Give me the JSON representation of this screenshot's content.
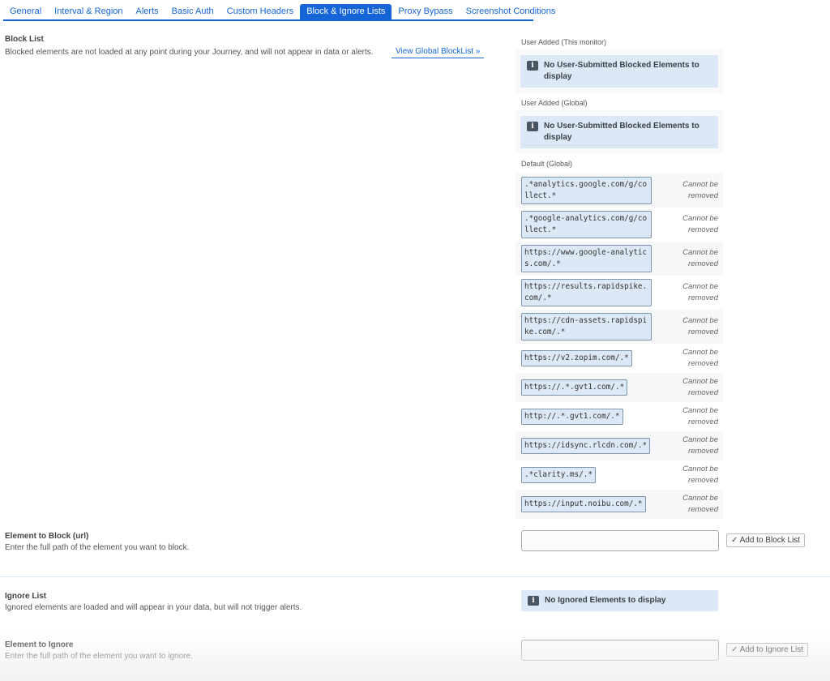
{
  "tabs": [
    {
      "label": "General",
      "active": false
    },
    {
      "label": "Interval & Region",
      "active": false
    },
    {
      "label": "Alerts",
      "active": false
    },
    {
      "label": "Basic Auth",
      "active": false
    },
    {
      "label": "Custom Headers",
      "active": false
    },
    {
      "label": "Block & Ignore Lists",
      "active": true
    },
    {
      "label": "Proxy Bypass",
      "active": false
    },
    {
      "label": "Screenshot Conditions",
      "active": false
    }
  ],
  "block_list": {
    "title": "Block List",
    "description": "Blocked elements are not loaded at any point during your Journey, and will not appear in data or alerts.",
    "global_link": "View Global BlockList »",
    "groups": {
      "this_monitor": {
        "label": "User Added (This monitor)",
        "empty_message": "No User-Submitted Blocked Elements to display"
      },
      "global": {
        "label": "User Added (Global)",
        "empty_message": "No User-Submitted Blocked Elements to display"
      },
      "default": {
        "label": "Default (Global)",
        "note": "Cannot be removed",
        "rules": [
          ".*analytics.google.com/g/collect.*",
          ".*google-analytics.com/g/collect.*",
          "https://www.google-analytics.com/.*",
          "https://results.rapidspike.com/.*",
          "https://cdn-assets.rapidspike.com/.*",
          "https://v2.zopim.com/.*",
          "https://.*.gvt1.com/.*",
          "http://.*.gvt1.com/.*",
          "https://idsync.rlcdn.com/.*",
          ".*clarity.ms/.*",
          "https://input.noibu.com/.*"
        ]
      }
    }
  },
  "element_to_block": {
    "title": "Element to Block (url)",
    "description": "Enter the full path of the element you want to block.",
    "value": "",
    "button_label": "✓ Add to Block List"
  },
  "ignore_list": {
    "title": "Ignore List",
    "description": "Ignored elements are loaded and will appear in your data, but will not trigger alerts.",
    "empty_message": "No Ignored Elements to display"
  },
  "element_to_ignore": {
    "title": "Element to Ignore",
    "description": "Enter the full path of the element you want to ignore.",
    "value": "",
    "button_label": "✓ Add to Ignore List"
  },
  "icons": {
    "info": "i"
  },
  "colors": {
    "accent": "#1565d8",
    "info_bg": "#dce8f5",
    "info_icon_bg": "#4a5562"
  }
}
